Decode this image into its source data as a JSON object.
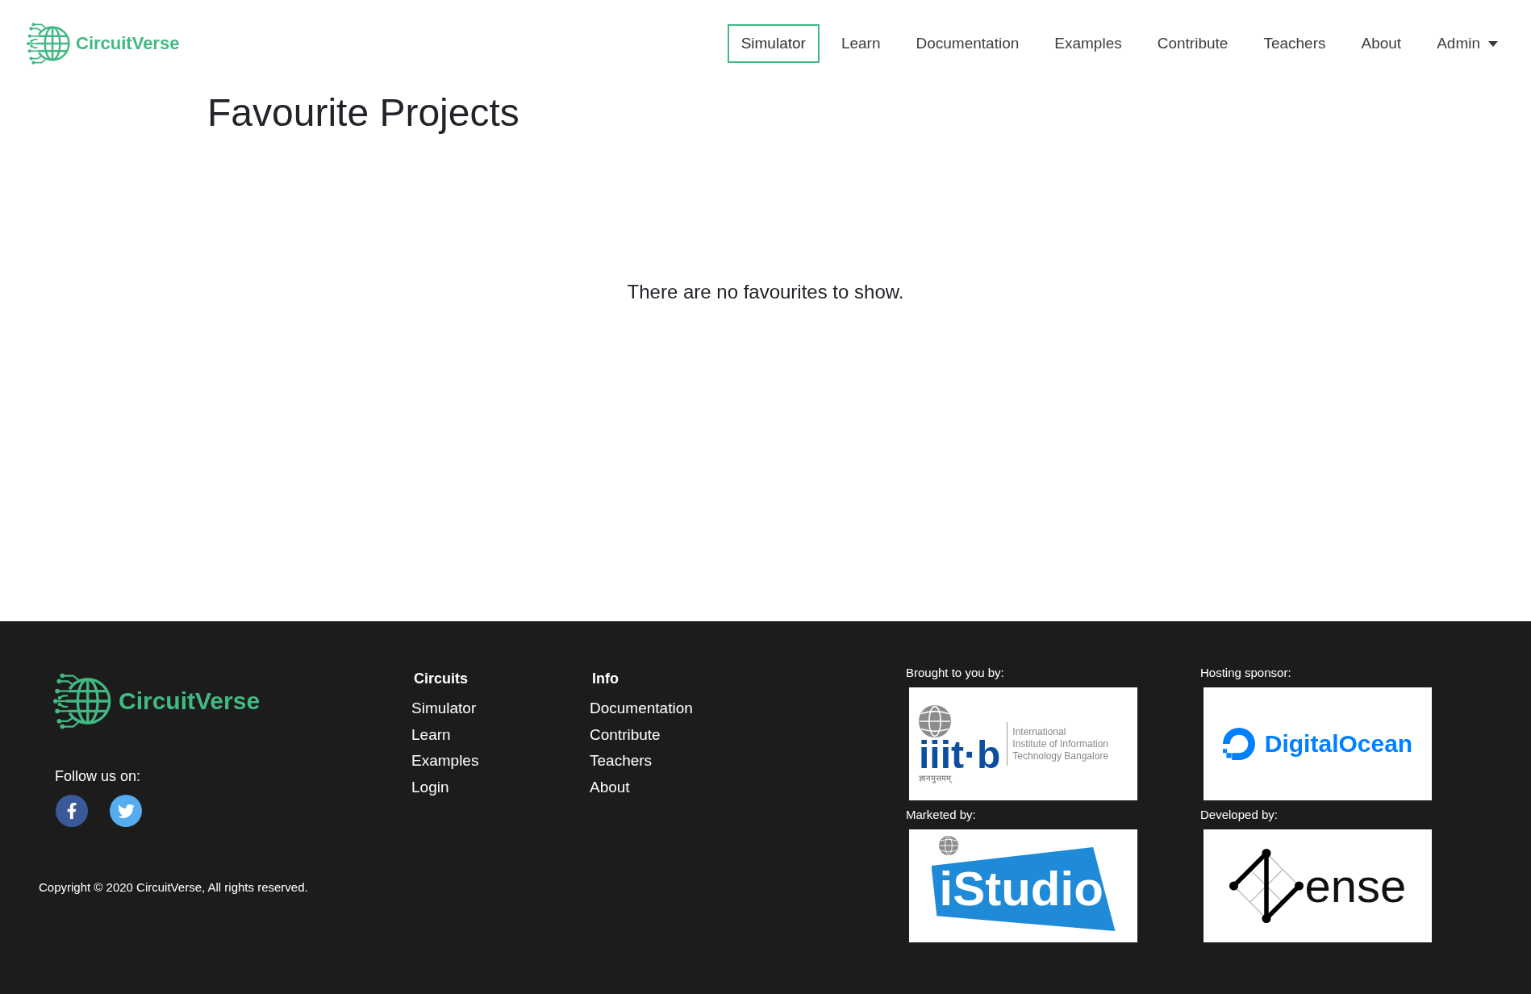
{
  "header": {
    "logo": {
      "name": "CircuitVerse"
    },
    "nav": [
      {
        "label": "Simulator",
        "selected": true,
        "dropdown": false
      },
      {
        "label": "Learn",
        "selected": false,
        "dropdown": false
      },
      {
        "label": "Documentation",
        "selected": false,
        "dropdown": false
      },
      {
        "label": "Examples",
        "selected": false,
        "dropdown": false
      },
      {
        "label": "Contribute",
        "selected": false,
        "dropdown": false
      },
      {
        "label": "Teachers",
        "selected": false,
        "dropdown": false
      },
      {
        "label": "About",
        "selected": false,
        "dropdown": false
      },
      {
        "label": "Admin",
        "selected": false,
        "dropdown": true
      }
    ]
  },
  "page": {
    "title": "Favourite Projects",
    "empty_message": "There are no favourites to show."
  },
  "footer": {
    "logo": {
      "name": "CircuitVerse"
    },
    "follow_label": "Follow us on:",
    "social": [
      {
        "kind": "facebook",
        "color": "#3b5998"
      },
      {
        "kind": "twitter",
        "color": "#55acee"
      }
    ],
    "columns": [
      {
        "heading": "Circuits",
        "links": [
          "Simulator",
          "Learn",
          "Examples",
          "Login"
        ]
      },
      {
        "heading": "Info",
        "links": [
          "Documentation",
          "Contribute",
          "Teachers",
          "About"
        ]
      }
    ],
    "sponsors": [
      {
        "label": "Brought to you by:",
        "kind": "iiitb",
        "logo": {
          "mark": "iiit·b",
          "motto": "ज्ञानमुत्तमम्",
          "lines": [
            "International",
            "Institute of Information",
            "Technology Bangalore"
          ]
        }
      },
      {
        "label": "Hosting sponsor:",
        "kind": "digitalocean",
        "logo": {
          "name": "DigitalOcean"
        }
      },
      {
        "label": "Marketed by:",
        "kind": "istudio",
        "logo": {
          "name": "iStudio"
        }
      },
      {
        "label": "Developed by:",
        "kind": "vense",
        "logo": {
          "name": "ense"
        }
      }
    ],
    "copyright": "Copyright © 2020 CircuitVerse, All rights reserved."
  }
}
